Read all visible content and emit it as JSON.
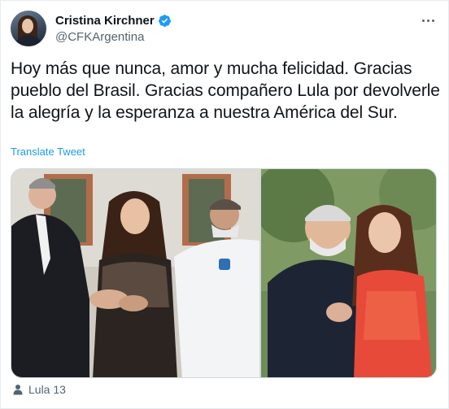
{
  "author": {
    "display_name": "Cristina Kirchner",
    "handle": "@CFKArgentina",
    "verified": true
  },
  "tweet": {
    "text": "Hoy más que nunca, amor y mucha felicidad. Gracias pueblo del Brasil. Gracias compañero Lula por devolverle la alegría y la esperanza a nuestra América del Sur.",
    "translate_label": "Translate Tweet"
  },
  "footer": {
    "label": "Lula 13",
    "icon": "person-icon"
  },
  "icons": {
    "verified": "verified-badge-icon",
    "more": "more-options-icon"
  },
  "colors": {
    "accent": "#1d9bf0",
    "secondary_text": "#536471",
    "primary_text": "#0f1419"
  }
}
